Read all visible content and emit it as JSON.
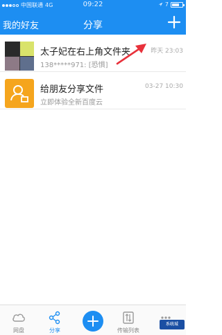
{
  "status_bar": {
    "carrier": "中国联通",
    "network": "4G",
    "time": "09:22",
    "battery_text": "7",
    "battery_level": 0.7
  },
  "nav": {
    "left_label": "我的好友",
    "title": "分享"
  },
  "shares": [
    {
      "title": "太子妃在右上角文件夹",
      "subtitle": "138*****971: [恐惧]",
      "time": "昨天 23:03"
    },
    {
      "title": "给朋友分享文件",
      "subtitle": "立即体验全新百度云",
      "time": "03-27 10:30"
    }
  ],
  "tabs": [
    {
      "label": "网盘",
      "icon": "cloud-icon"
    },
    {
      "label": "分享",
      "icon": "share-icon"
    },
    {
      "label": "",
      "icon": "plus-icon"
    },
    {
      "label": "传输列表",
      "icon": "transfer-icon"
    },
    {
      "label": "",
      "icon": "more-icon"
    }
  ],
  "watermark": "系统城",
  "colors": {
    "brand_blue": "#1d8ef2",
    "share_orange": "#f5a51d",
    "arrow_red": "#e8313b"
  }
}
